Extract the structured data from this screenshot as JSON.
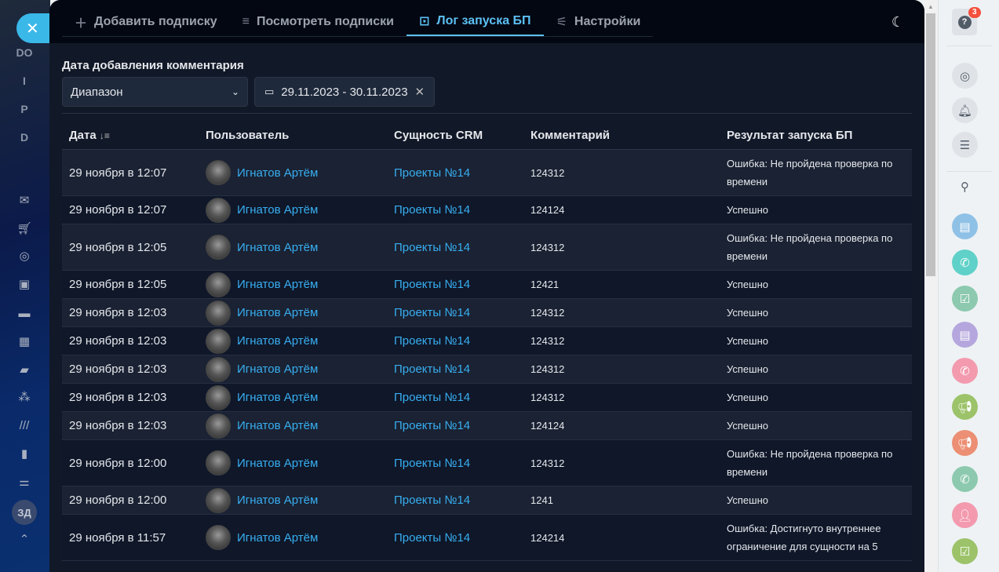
{
  "leftbar": {
    "letters": [
      "DO",
      "I",
      "P",
      "D"
    ],
    "avatar": "ЗД"
  },
  "tabs": [
    {
      "label": "Добавить подписку",
      "icon": "plus-icon"
    },
    {
      "label": "Посмотреть подписки",
      "icon": "list-icon"
    },
    {
      "label": "Лог запуска БП",
      "icon": "log-icon"
    },
    {
      "label": "Настройки",
      "icon": "sliders-icon"
    }
  ],
  "filter": {
    "label": "Дата добавления комментария",
    "range_type": "Диапазон",
    "date_range": "29.11.2023 - 30.11.2023"
  },
  "table": {
    "headers": [
      "Дата",
      "Пользователь",
      "Сущность CRM",
      "Комментарий",
      "Результат запуска БП"
    ],
    "rows": [
      {
        "date": "29 ноября в 12:07",
        "user": "Игнатов Артём",
        "entity": "Проекты №14",
        "comment": "124312",
        "result": "Ошибка: Не пройдена проверка по времени"
      },
      {
        "date": "29 ноября в 12:07",
        "user": "Игнатов Артём",
        "entity": "Проекты №14",
        "comment": "124124",
        "result": "Успешно"
      },
      {
        "date": "29 ноября в 12:05",
        "user": "Игнатов Артём",
        "entity": "Проекты №14",
        "comment": "124312",
        "result": "Ошибка: Не пройдена проверка по времени"
      },
      {
        "date": "29 ноября в 12:05",
        "user": "Игнатов Артём",
        "entity": "Проекты №14",
        "comment": "12421",
        "result": "Успешно"
      },
      {
        "date": "29 ноября в 12:03",
        "user": "Игнатов Артём",
        "entity": "Проекты №14",
        "comment": "124312",
        "result": "Успешно"
      },
      {
        "date": "29 ноября в 12:03",
        "user": "Игнатов Артём",
        "entity": "Проекты №14",
        "comment": "124312",
        "result": "Успешно"
      },
      {
        "date": "29 ноября в 12:03",
        "user": "Игнатов Артём",
        "entity": "Проекты №14",
        "comment": "124312",
        "result": "Успешно"
      },
      {
        "date": "29 ноября в 12:03",
        "user": "Игнатов Артём",
        "entity": "Проекты №14",
        "comment": "124312",
        "result": "Успешно"
      },
      {
        "date": "29 ноября в 12:03",
        "user": "Игнатов Артём",
        "entity": "Проекты №14",
        "comment": "124124",
        "result": "Успешно"
      },
      {
        "date": "29 ноября в 12:00",
        "user": "Игнатов Артём",
        "entity": "Проекты №14",
        "comment": "124312",
        "result": "Ошибка: Не пройдена проверка по времени"
      },
      {
        "date": "29 ноября в 12:00",
        "user": "Игнатов Артём",
        "entity": "Проекты №14",
        "comment": "1241",
        "result": "Успешно"
      },
      {
        "date": "29 ноября в 11:57",
        "user": "Игнатов Артём",
        "entity": "Проекты №14",
        "comment": "124214",
        "result": "Ошибка: Достигнуто внутреннее ограничение для сущности на 5"
      }
    ]
  },
  "rightpanel": {
    "help_badge": "3"
  }
}
